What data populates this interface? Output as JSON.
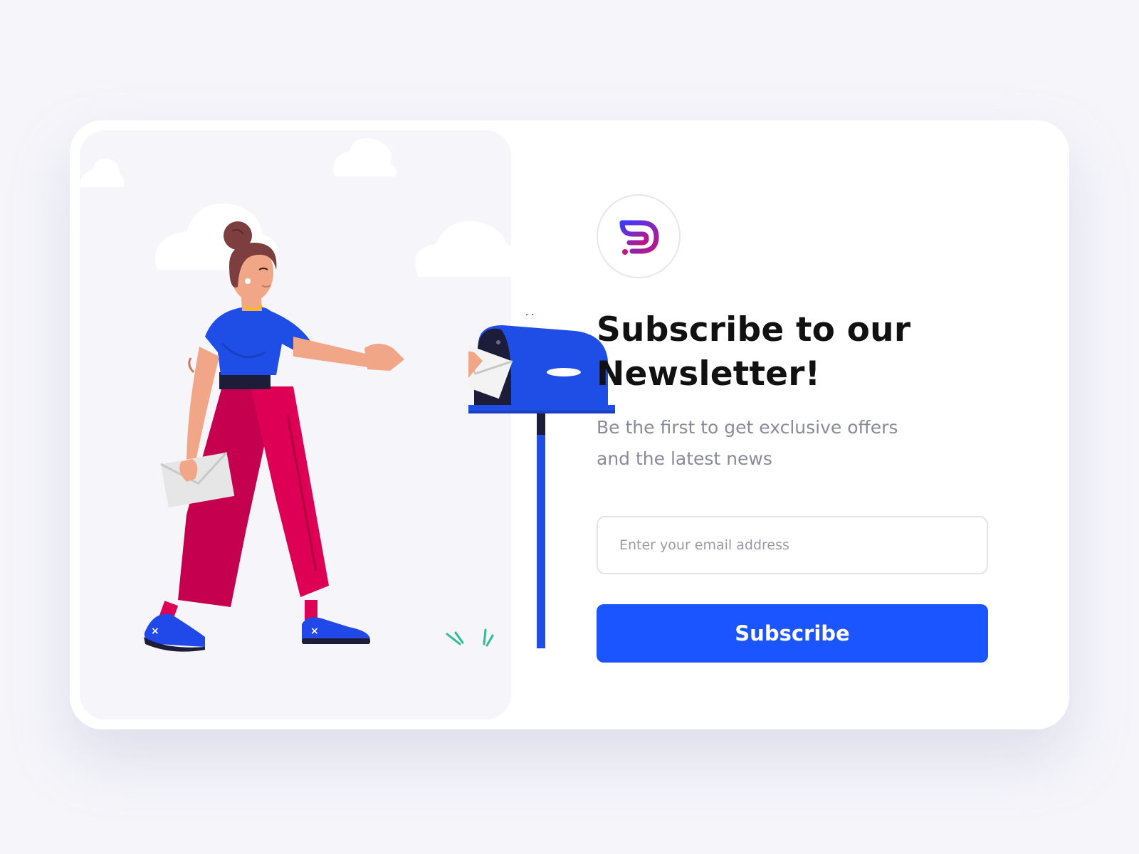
{
  "newsletter": {
    "title_line1": "Subscribe to our",
    "title_line2": "Newsletter!",
    "subtitle_line1": "Be the first to get exclusive offers",
    "subtitle_line2": "and the latest news",
    "email_placeholder": "Enter your email address",
    "email_value": "",
    "subscribe_label": "Subscribe"
  },
  "theme": {
    "accent": "#1a55ff",
    "background": "#f5f5fa",
    "title_color": "#111111",
    "subtitle_color": "#8a8a99",
    "logo_gradient": [
      "#3a3bff",
      "#c3147f"
    ]
  },
  "icons": {
    "logo": "brand-logo-icon",
    "illustration": "woman-mailing-letter-illustration"
  }
}
